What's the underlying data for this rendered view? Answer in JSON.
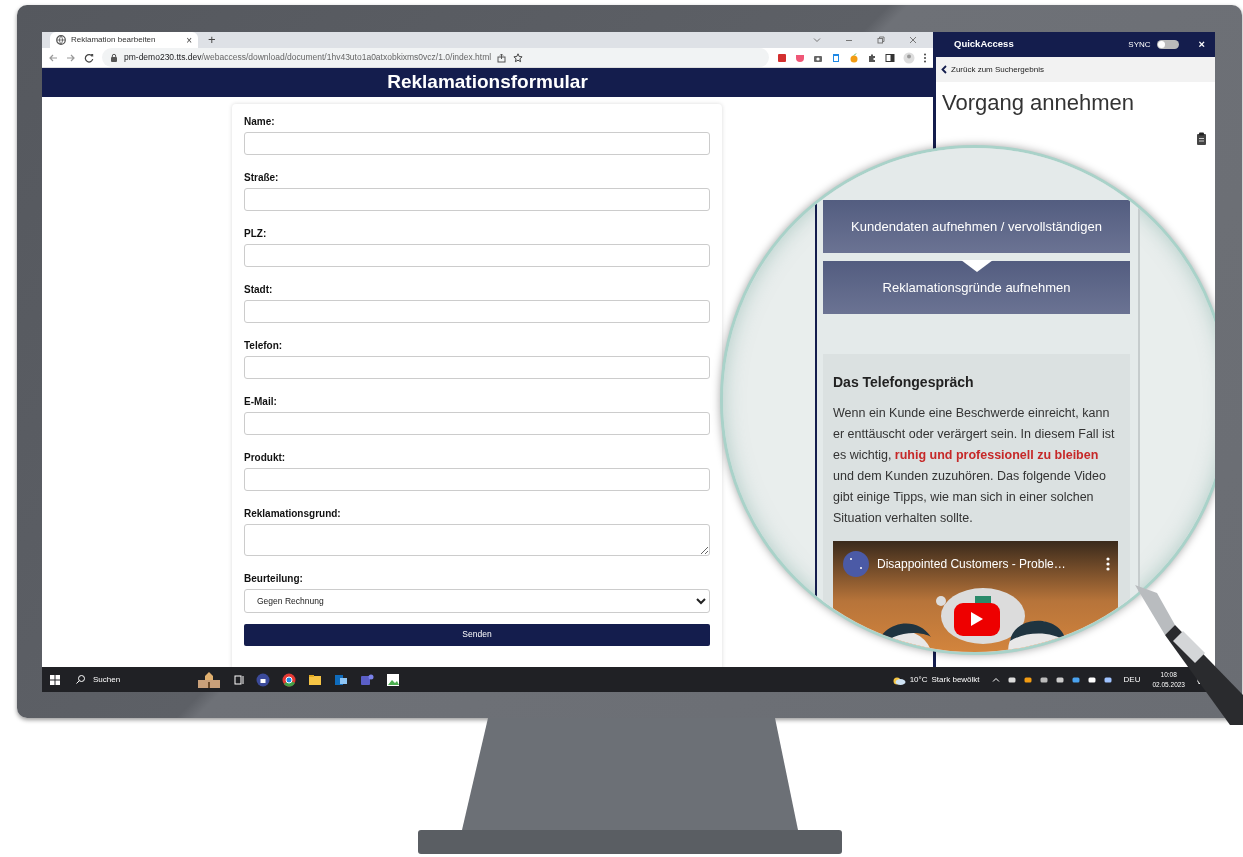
{
  "browser": {
    "tab": {
      "title": "Reklamation bearbeiten",
      "close": "×",
      "selected": true
    },
    "new_tab": "+",
    "url_host": "pm-demo230.tts.dev",
    "url_path": "/webaccess/download/document/1hv43uto1a0atxobkixms0vcz/1.0/index.html"
  },
  "page": {
    "heading": "Reklamationsformular",
    "fields": [
      {
        "label": "Name:",
        "kind": "input"
      },
      {
        "label": "Straße:",
        "kind": "input"
      },
      {
        "label": "PLZ:",
        "kind": "input"
      },
      {
        "label": "Stadt:",
        "kind": "input"
      },
      {
        "label": "Telefon:",
        "kind": "input"
      },
      {
        "label": "E-Mail:",
        "kind": "input"
      },
      {
        "label": "Produkt:",
        "kind": "input"
      },
      {
        "label": "Reklamationsgrund:",
        "kind": "textarea"
      },
      {
        "label": "Beurteilung:",
        "kind": "select",
        "value": "Gegen Rechnung"
      }
    ],
    "submit": "Senden"
  },
  "quickaccess": {
    "title": "QuickAccess",
    "sync_label": "SYNC",
    "sync_on": false,
    "close": "×",
    "back": "Zurück zum Suchergebnis",
    "heading": "Vorgang annehmen"
  },
  "magnifier": {
    "steps": [
      {
        "label": "Kundendaten aufnehmen / vervollständigen"
      },
      {
        "label": "Reklamationsgründe aufnehmen"
      }
    ],
    "section_title": "Das Telefongespräch",
    "text": "Wenn ein Kunde eine Beschwerde einreicht, kann er enttäuscht oder verärgert sein. In diesem Fall ist es wichtig, **ruhig und professionell zu bleiben** und dem Kunden zuzuhören. Das folgende Video gibt einige Tipps, wie man sich in einer solchen Situation verhalten sollte.",
    "video": {
      "title": "Disappointed Customers - Proble…"
    }
  },
  "taskbar": {
    "search": "Suchen",
    "temperature": "10°C",
    "weather": "Stark bewölkt",
    "language": "DEU",
    "time": "10:08",
    "date": "02.05.2023"
  }
}
